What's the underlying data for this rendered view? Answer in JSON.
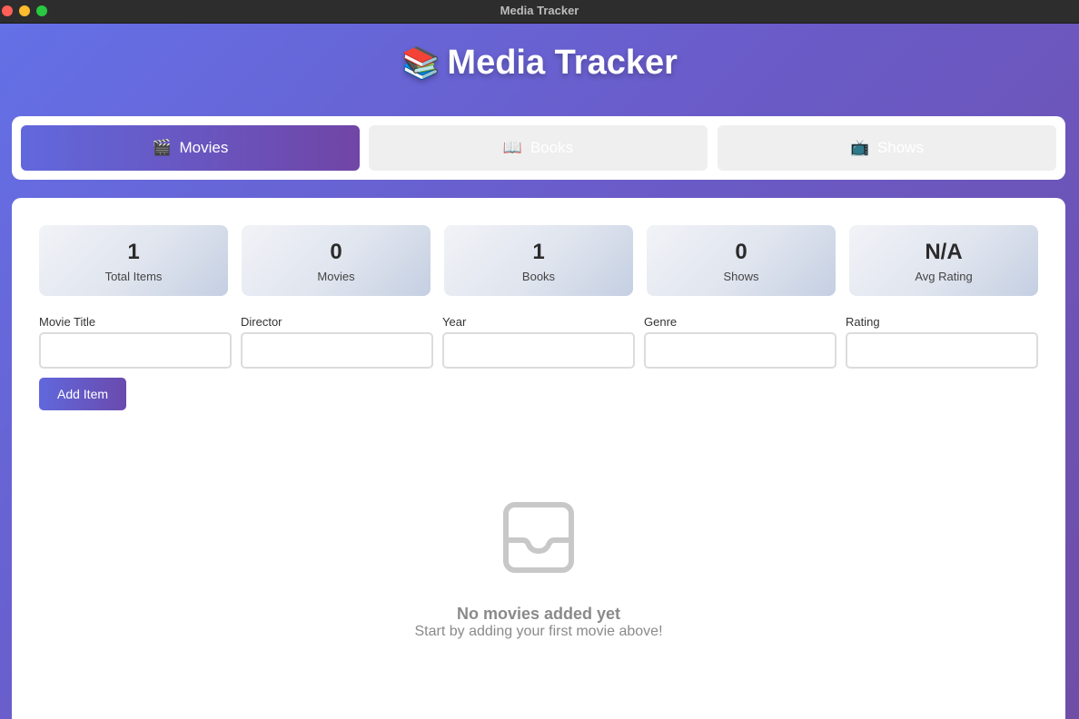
{
  "window": {
    "title": "Media Tracker"
  },
  "header": {
    "logo": "📚",
    "title": "Media Tracker"
  },
  "tabs": [
    {
      "icon": "🎬",
      "label": "Movies",
      "active": true
    },
    {
      "icon": "📖",
      "label": "Books",
      "active": false
    },
    {
      "icon": "📺",
      "label": "Shows",
      "active": false
    }
  ],
  "stats": [
    {
      "value": "1",
      "label": "Total Items"
    },
    {
      "value": "0",
      "label": "Movies"
    },
    {
      "value": "1",
      "label": "Books"
    },
    {
      "value": "0",
      "label": "Shows"
    },
    {
      "value": "N/A",
      "label": "Avg Rating"
    }
  ],
  "form": {
    "fields": [
      {
        "label": "Movie Title",
        "value": "",
        "placeholder": ""
      },
      {
        "label": "Director",
        "value": "",
        "placeholder": ""
      },
      {
        "label": "Year",
        "value": "",
        "placeholder": ""
      },
      {
        "label": "Genre",
        "value": "",
        "placeholder": ""
      },
      {
        "label": "Rating",
        "value": "",
        "placeholder": ""
      }
    ],
    "submit_label": "Add Item"
  },
  "empty_state": {
    "icon": "inbox-icon",
    "title": "No movies added yet",
    "subtitle": "Start by adding your first movie above!"
  },
  "colors": {
    "accent_start": "#6168dc",
    "accent_end": "#7045a6",
    "background": "#6a5bc8",
    "empty_text": "#8a8a8a"
  }
}
